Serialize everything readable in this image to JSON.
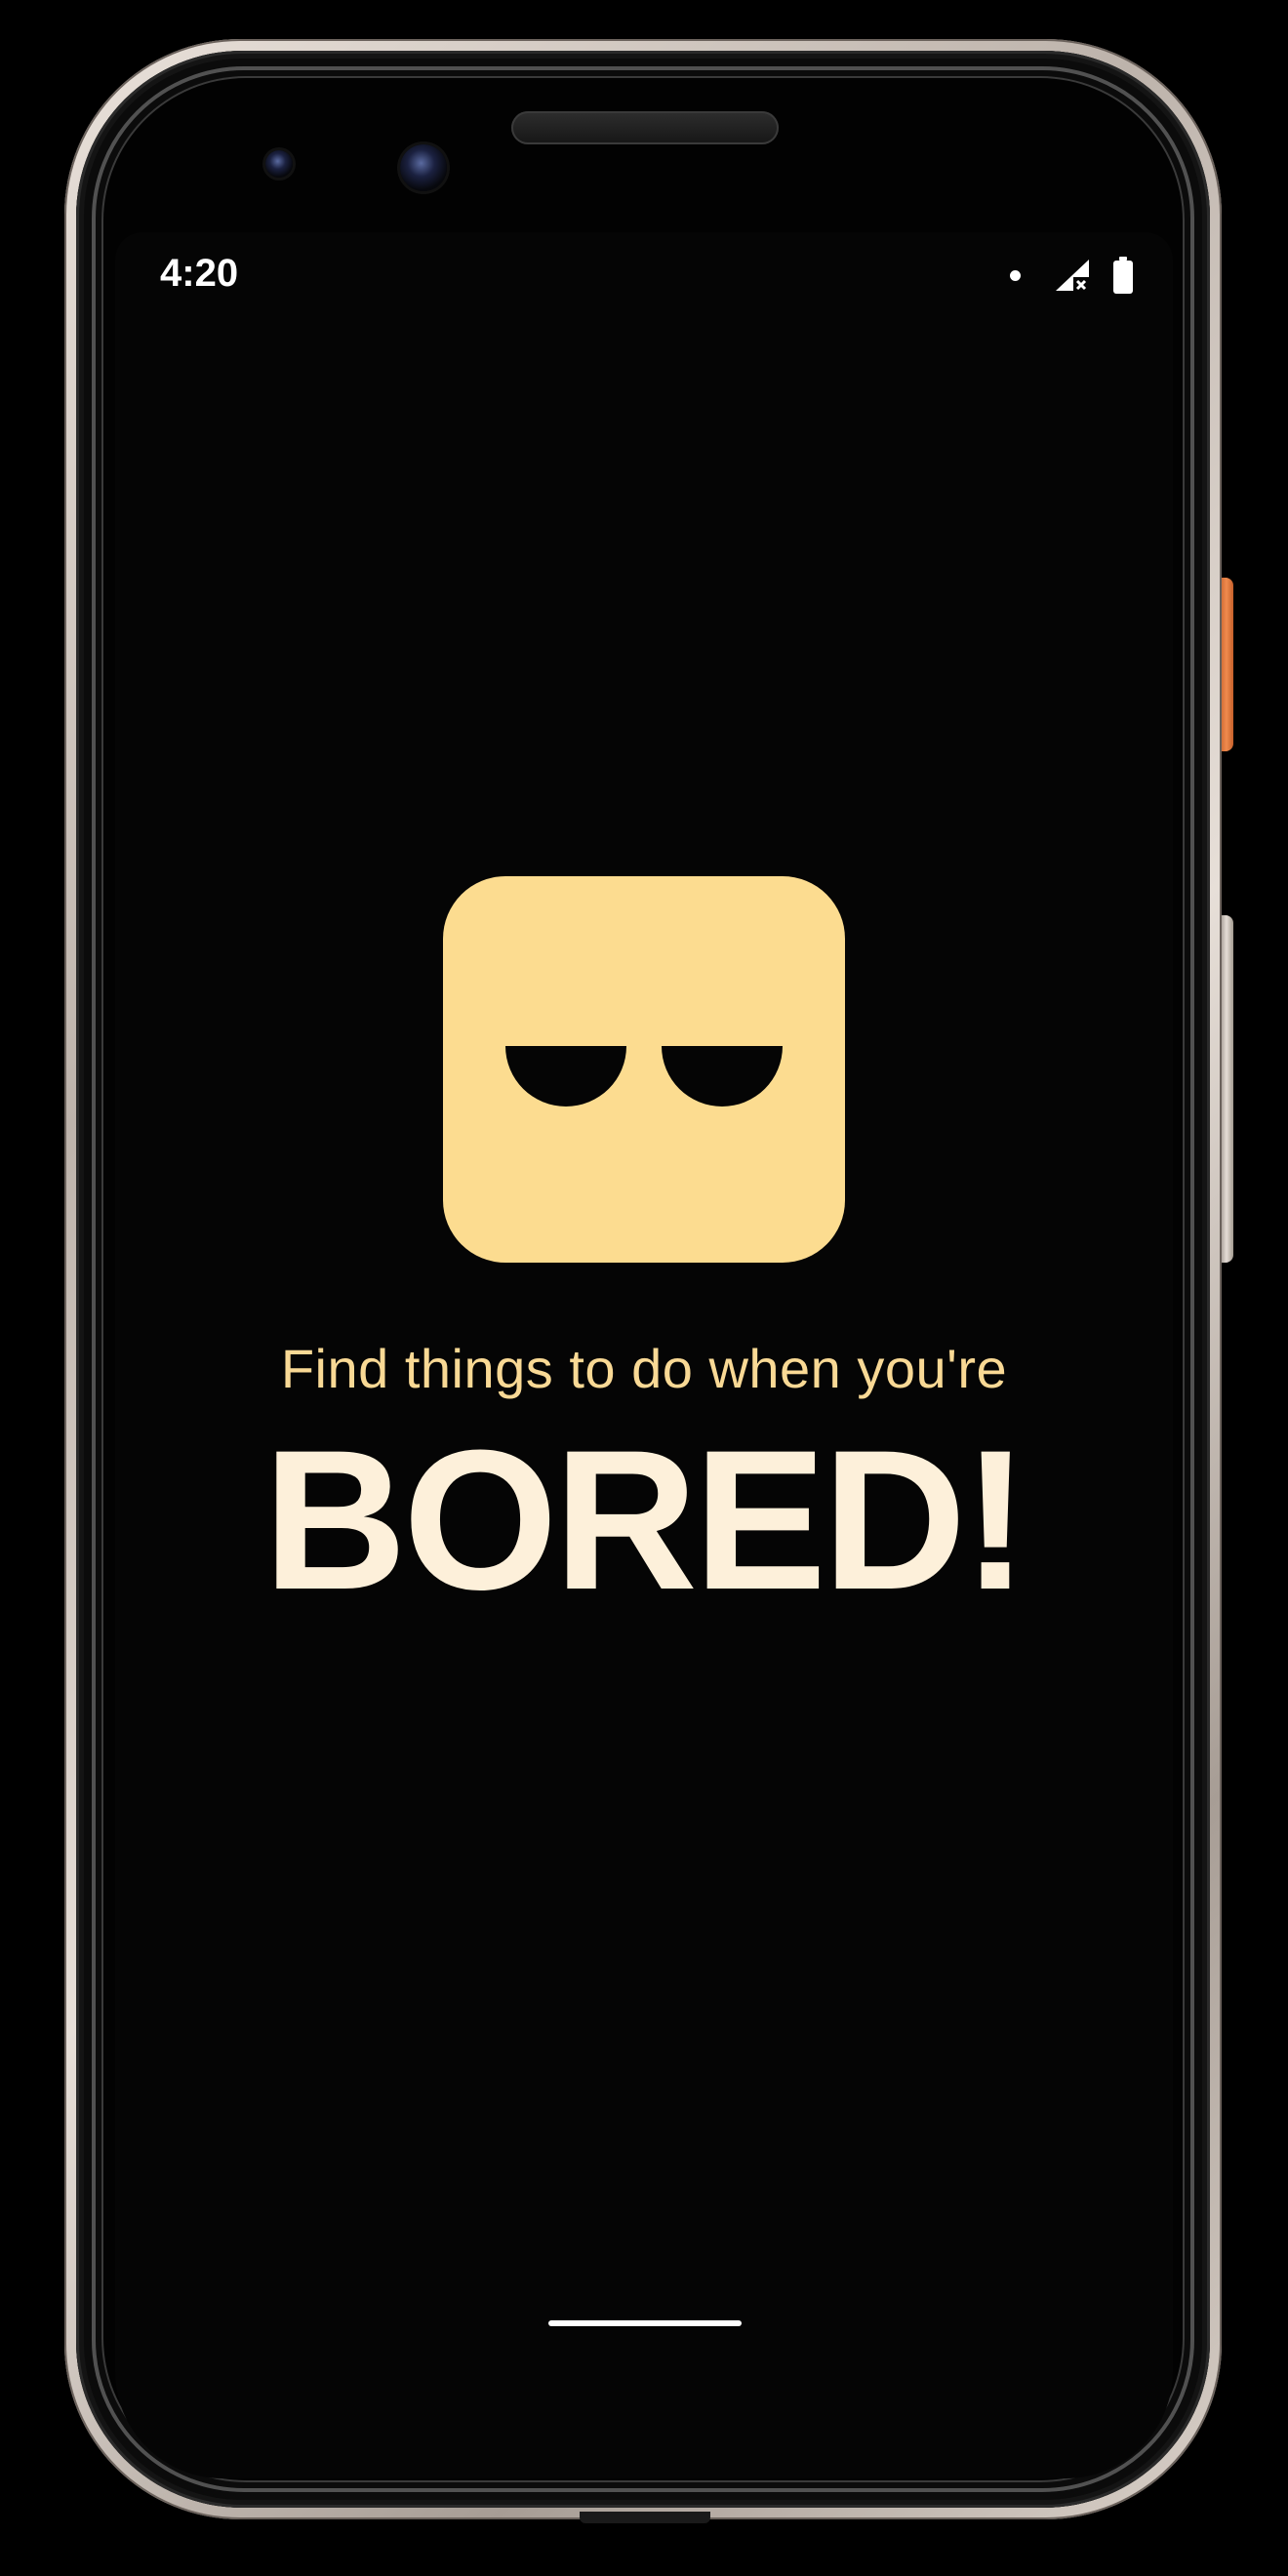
{
  "status_bar": {
    "time": "4:20",
    "icons": [
      "notification-dot-icon",
      "signal-no-service-icon",
      "battery-icon"
    ]
  },
  "app": {
    "logo_icon": "sleepy-face-icon",
    "tagline": "Find things to do when you're",
    "headline": "BORED!"
  },
  "colors": {
    "background": "#050505",
    "logo": "#fcdc90",
    "tagline": "#f9d995",
    "headline": "#fdf0da"
  },
  "navigation": {
    "gesture_bar": "home-indicator"
  }
}
